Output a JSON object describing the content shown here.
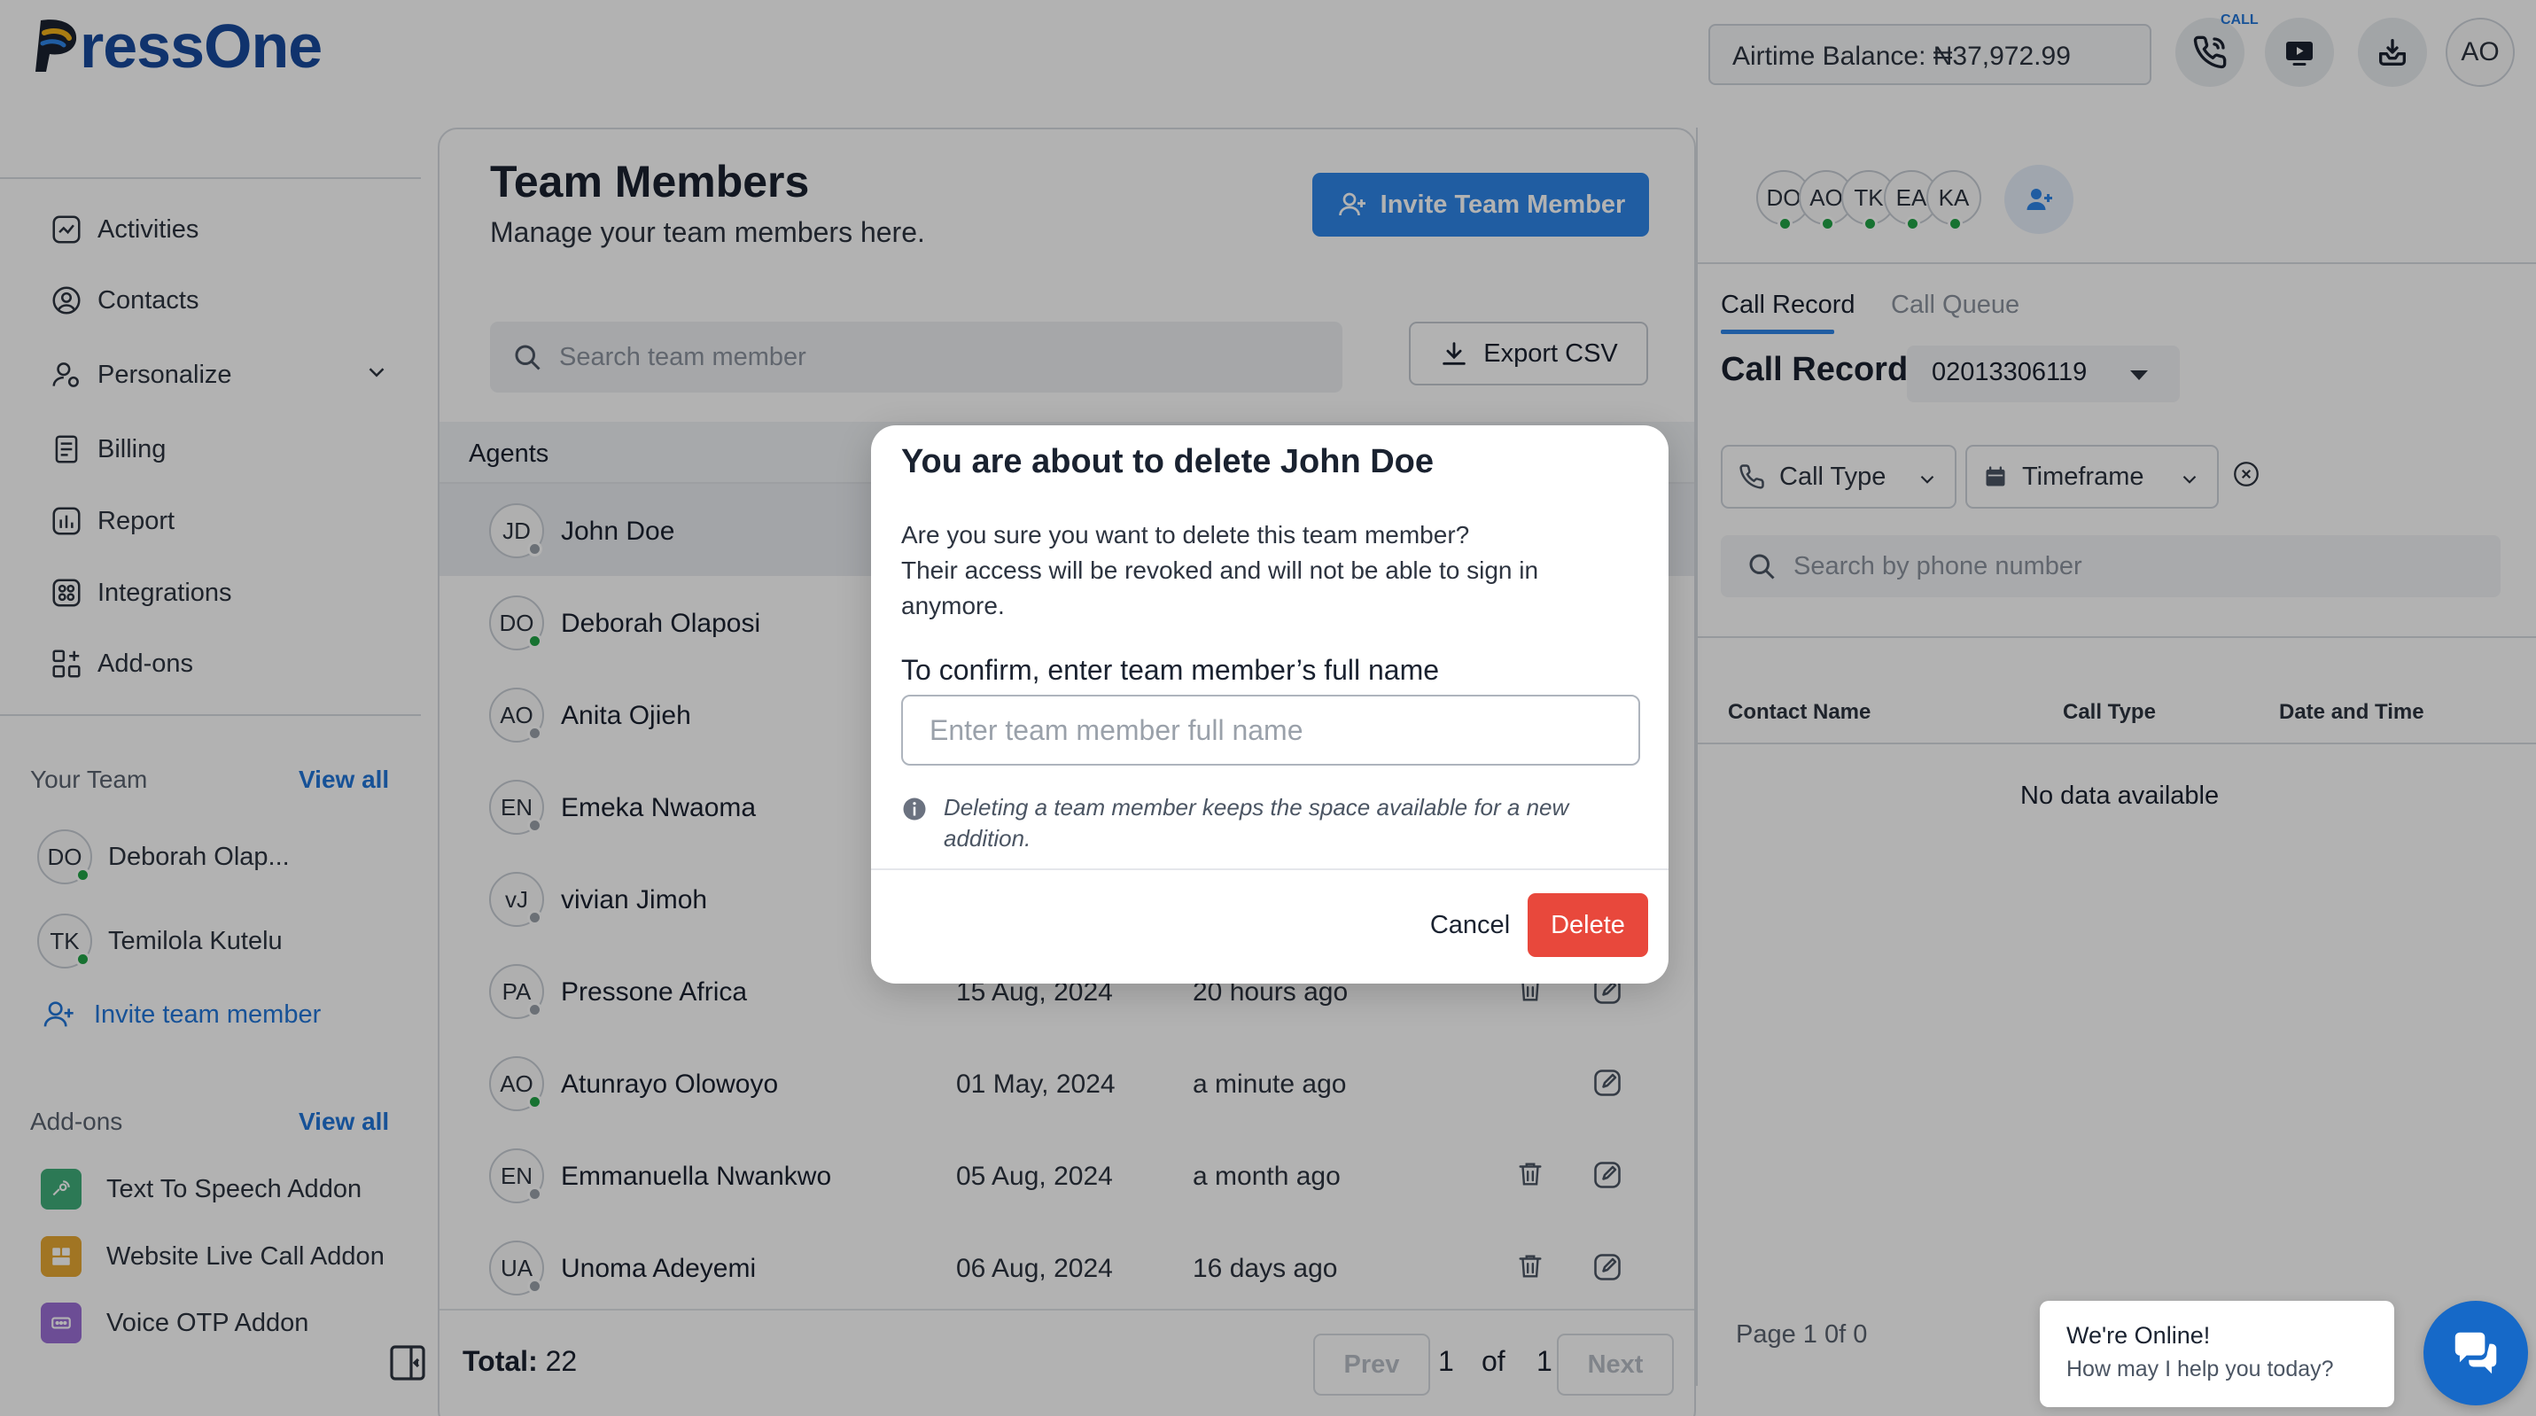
{
  "app": {
    "logo_text": "ressOne",
    "airtime_label": "Airtime Balance: ₦37,972.99",
    "call_tag": "CALL",
    "user_initials": "AO"
  },
  "sidebar": {
    "nav": [
      {
        "label": "Activities",
        "icon": "activity-icon"
      },
      {
        "label": "Contacts",
        "icon": "contacts-icon"
      },
      {
        "label": "Personalize",
        "icon": "personalize-icon"
      },
      {
        "label": "Billing",
        "icon": "billing-icon"
      },
      {
        "label": "Report",
        "icon": "report-icon"
      },
      {
        "label": "Integrations",
        "icon": "integrations-icon"
      },
      {
        "label": "Add-ons",
        "icon": "addons-icon"
      }
    ],
    "your_team_title": "Your Team",
    "your_team_view_all": "View all",
    "team": [
      {
        "initials": "DO",
        "name": "Deborah Olap...",
        "online": true
      },
      {
        "initials": "TK",
        "name": "Temilola Kutelu",
        "online": true
      }
    ],
    "invite_label": "Invite team member",
    "addons_title": "Add-ons",
    "addons_view_all": "View all",
    "addons": [
      {
        "label": "Text To Speech Addon",
        "color": "#3fae7a"
      },
      {
        "label": "Website Live Call Addon",
        "color": "#e7a833"
      },
      {
        "label": "Voice OTP Addon",
        "color": "#9b6fd6"
      }
    ]
  },
  "main": {
    "title": "Team Members",
    "subtitle": "Manage your team members here.",
    "invite_button": "Invite Team Member",
    "search_placeholder": "Search team member",
    "export_button": "Export CSV",
    "agents_label": "Agents",
    "members": [
      {
        "initials": "JD",
        "name": "John Doe",
        "date": "",
        "last_seen": "",
        "online": false,
        "can_delete": false,
        "can_edit": false
      },
      {
        "initials": "DO",
        "name": "Deborah Olaposi",
        "date": "",
        "last_seen": "",
        "online": true,
        "can_delete": false,
        "can_edit": false
      },
      {
        "initials": "AO",
        "name": "Anita Ojieh",
        "date": "",
        "last_seen": "",
        "online": false,
        "can_delete": false,
        "can_edit": false
      },
      {
        "initials": "EN",
        "name": "Emeka Nwaoma",
        "date": "",
        "last_seen": "",
        "online": false,
        "can_delete": false,
        "can_edit": false
      },
      {
        "initials": "vJ",
        "name": "vivian Jimoh",
        "date": "",
        "last_seen": "",
        "online": false,
        "can_delete": false,
        "can_edit": false
      },
      {
        "initials": "PA",
        "name": "Pressone Africa",
        "date": "15 Aug, 2024",
        "last_seen": "20 hours ago",
        "online": false,
        "can_delete": true,
        "can_edit": true
      },
      {
        "initials": "AO",
        "name": "Atunrayo Olowoyo",
        "date": "01 May, 2024",
        "last_seen": "a minute ago",
        "online": true,
        "can_delete": false,
        "can_edit": true
      },
      {
        "initials": "EN",
        "name": "Emmanuella Nwankwo",
        "date": "05 Aug, 2024",
        "last_seen": "a month ago",
        "online": false,
        "can_delete": true,
        "can_edit": true
      },
      {
        "initials": "UA",
        "name": "Unoma Adeyemi",
        "date": "06 Aug, 2024",
        "last_seen": "16 days ago",
        "online": false,
        "can_delete": true,
        "can_edit": true
      }
    ],
    "total_label": "Total:",
    "total_value": "22",
    "pager": {
      "prev": "Prev",
      "current": "1",
      "of": "of",
      "total": "1",
      "next": "Next"
    }
  },
  "right_panel": {
    "online_avatars": [
      "DO",
      "AO",
      "TK",
      "EA",
      "KA"
    ],
    "tabs": [
      {
        "label": "Call Record",
        "active": true
      },
      {
        "label": "Call Queue",
        "active": false
      }
    ],
    "record_title": "Call Record",
    "record_number": "02013306119",
    "filter_call_type": "Call Type",
    "filter_timeframe": "Timeframe",
    "search_placeholder": "Search by phone number",
    "columns": [
      "Contact Name",
      "Call Type",
      "Date and Time"
    ],
    "empty_text": "No data available",
    "page_text": "Page 1 0f 0"
  },
  "modal": {
    "title": "You are about to delete John Doe",
    "body_line1": "Are you sure you want to delete this team member?",
    "body_line2": "Their access will be revoked and will not be able to sign in anymore.",
    "confirm_label": "To confirm, enter team member’s full name",
    "input_placeholder": "Enter team member full name",
    "input_value": "",
    "note": "Deleting a team member keeps the space available for a new addition.",
    "cancel": "Cancel",
    "delete": "Delete"
  },
  "chat": {
    "title": "We're Online!",
    "subtitle": "How may I help you today?"
  },
  "colors": {
    "brand": "#174a9c",
    "accent": "#2e86e8",
    "danger": "#e8483c",
    "online": "#22a447"
  }
}
